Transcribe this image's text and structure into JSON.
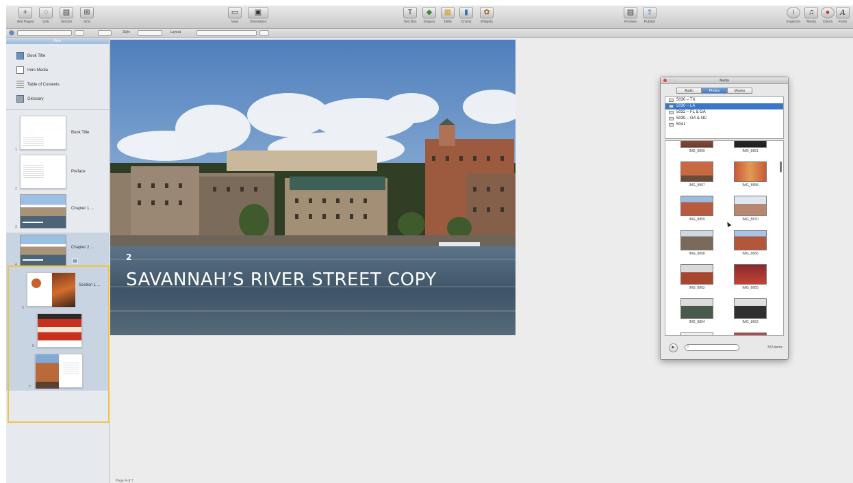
{
  "toolbar": {
    "left": [
      {
        "label": "Add Pages",
        "icon": "plus-icon",
        "glyph": "+"
      },
      {
        "label": "Link",
        "icon": "link-icon",
        "glyph": "◌"
      },
      {
        "label": "Section",
        "icon": "section-icon",
        "glyph": "▤"
      },
      {
        "label": "Grid",
        "icon": "grid-icon",
        "glyph": "⊞"
      }
    ],
    "view": [
      {
        "label": "View",
        "icon": "view-icon",
        "glyph": "▭"
      },
      {
        "label": "Orientation",
        "icon": "orientation-icon",
        "glyph": "▣"
      }
    ],
    "insert": [
      {
        "label": "Text Box",
        "icon": "textbox-icon",
        "glyph": "T"
      },
      {
        "label": "Shapes",
        "icon": "shapes-icon",
        "glyph": "◆"
      },
      {
        "label": "Table",
        "icon": "table-icon",
        "glyph": "▦"
      },
      {
        "label": "Charts",
        "icon": "chart-icon",
        "glyph": "▮"
      },
      {
        "label": "Widgets",
        "icon": "widgets-icon",
        "glyph": "✿"
      }
    ],
    "preview": [
      {
        "label": "Preview",
        "icon": "preview-icon",
        "glyph": "▤"
      },
      {
        "label": "Publish",
        "icon": "publish-icon",
        "glyph": "⇪"
      }
    ],
    "right": [
      {
        "label": "Inspector",
        "icon": "inspector-icon",
        "glyph": "i"
      },
      {
        "label": "Media",
        "icon": "media-icon",
        "glyph": "♫"
      },
      {
        "label": "Colors",
        "icon": "colors-icon",
        "glyph": "●"
      },
      {
        "label": "Fonts",
        "icon": "fonts-icon",
        "glyph": "A"
      }
    ]
  },
  "formatbar": {
    "style_label": "Style",
    "layout_label": "Layout"
  },
  "sidebar": {
    "header": "Book",
    "items": [
      {
        "label": "Book Title",
        "icon": "book-title-icon"
      },
      {
        "label": "Intro Media",
        "icon": "intro-media-icon"
      },
      {
        "label": "Table of Contents",
        "icon": "toc-icon"
      },
      {
        "label": "Glossary",
        "icon": "glossary-icon"
      }
    ],
    "pages": [
      {
        "num": "1",
        "label": "Book Title"
      },
      {
        "num": "2",
        "label": "Preface"
      },
      {
        "num": "3",
        "label": "Chapter 1 ..."
      },
      {
        "num": "4",
        "label": "Chapter 2 ..."
      },
      {
        "num": "5",
        "label": "Section 1 ..."
      },
      {
        "num": "6",
        "label": ""
      },
      {
        "num": "7",
        "label": ""
      }
    ]
  },
  "slide": {
    "number": "2",
    "title": "SAVANNAH’S RIVER STREET COPY"
  },
  "media": {
    "title": "Media",
    "tabs": [
      "Audio",
      "Photos",
      "Movies"
    ],
    "active_tab": "Photos",
    "albums": [
      {
        "label": "5030 – TX",
        "selected": false
      },
      {
        "label": "5030 – LA",
        "selected": true
      },
      {
        "label": "5032 – FL & GA",
        "selected": false
      },
      {
        "label": "5030 – GA & NC",
        "selected": false
      },
      {
        "label": "5041",
        "selected": false
      }
    ],
    "photos": [
      {
        "caption": "IMG_8860"
      },
      {
        "caption": "IMG_8861"
      },
      {
        "caption": "IMG_8857"
      },
      {
        "caption": "IMG_8858"
      },
      {
        "caption": "IMG_8859"
      },
      {
        "caption": "IMG_8870"
      },
      {
        "caption": "IMG_8868"
      },
      {
        "caption": "IMG_8866"
      },
      {
        "caption": "IMG_8862"
      },
      {
        "caption": "IMG_8865"
      },
      {
        "caption": "IMG_8864"
      },
      {
        "caption": "IMG_8863"
      }
    ],
    "search_placeholder": "",
    "count": "553 items"
  },
  "status": {
    "text": "Page 4 of 7"
  },
  "colors": {
    "selection": "#f0c24a",
    "accent": "#3a76c9"
  }
}
